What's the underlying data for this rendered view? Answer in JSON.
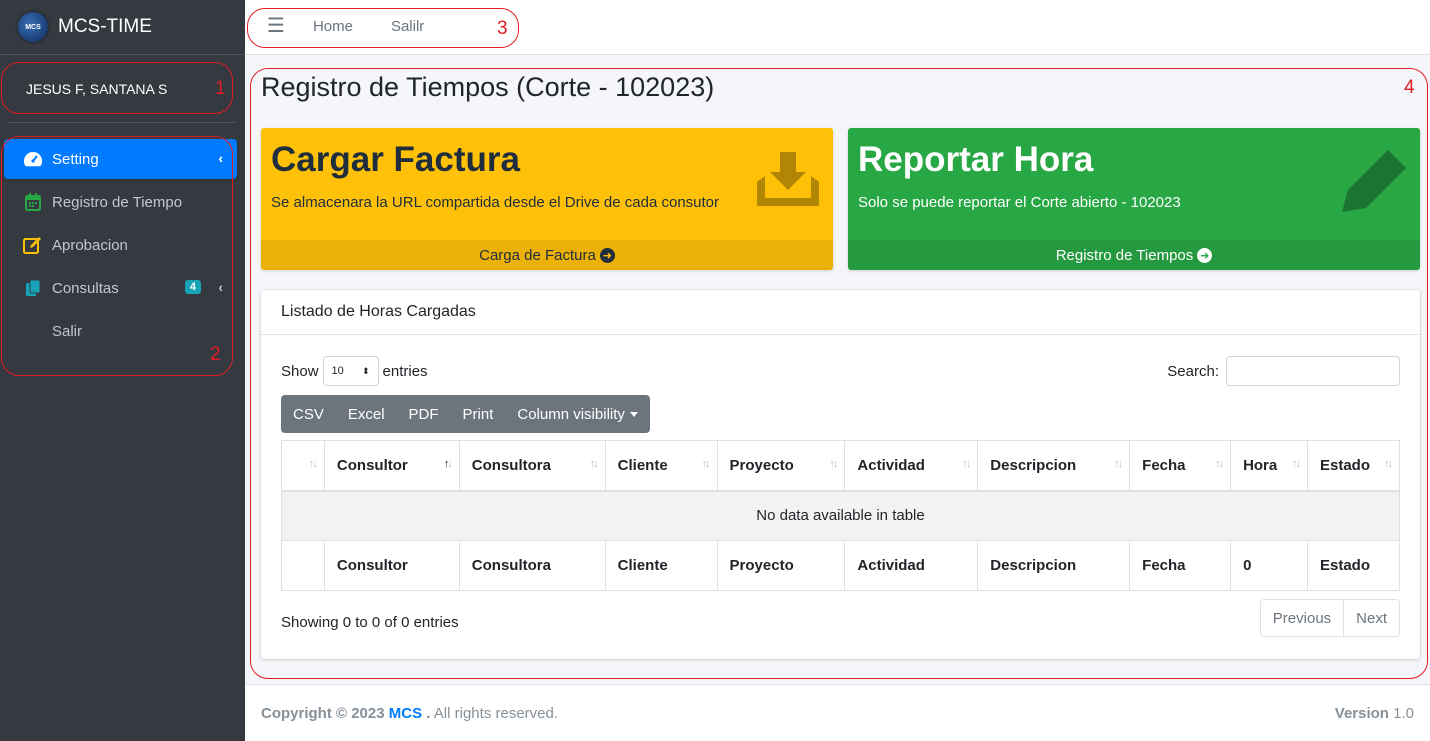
{
  "brand": {
    "name": "MCS-TIME",
    "logo_text": "MCS"
  },
  "user": {
    "name": "JESUS F, SANTANA S"
  },
  "sidebar": {
    "items": [
      {
        "label": "Setting",
        "icon": "tachometer-icon"
      },
      {
        "label": "Registro de Tiempo",
        "icon": "calendar-icon"
      },
      {
        "label": "Aprobacion",
        "icon": "edit-icon"
      },
      {
        "label": "Consultas",
        "icon": "copy-icon",
        "badge": "4"
      },
      {
        "label": "Salir"
      }
    ]
  },
  "navbar": {
    "links": [
      "Home",
      "Salilr"
    ]
  },
  "annotations": [
    "1",
    "2",
    "3",
    "4"
  ],
  "page": {
    "title": "Registro de Tiempos (Corte - 102023)"
  },
  "boxes": {
    "factura": {
      "title": "Cargar Factura",
      "text": "Se almacenara la URL compartida desde el Drive de cada consutor",
      "footer": "Carga de Factura",
      "color": "#ffc107"
    },
    "hora": {
      "title": "Reportar Hora",
      "text": "Solo se puede reportar el Corte abierto - 102023",
      "footer": "Registro de Tiempos",
      "color": "#28a745"
    }
  },
  "card": {
    "title": "Listado de Horas Cargadas",
    "show_label": "Show",
    "entries_value": "10",
    "entries_label": "entries",
    "search_label": "Search:",
    "buttons": [
      "CSV",
      "Excel",
      "PDF",
      "Print",
      "Column visibility"
    ],
    "columns": [
      "",
      "Consultor",
      "Consultora",
      "Cliente",
      "Proyecto",
      "Actividad",
      "Descripcion",
      "Fecha",
      "Hora",
      "Estado"
    ],
    "empty_message": "No data available in table",
    "footer_columns": [
      "",
      "Consultor",
      "Consultora",
      "Cliente",
      "Proyecto",
      "Actividad",
      "Descripcion",
      "Fecha",
      "0",
      "Estado"
    ],
    "info": "Showing 0 to 0 of 0 entries",
    "pagination": {
      "previous": "Previous",
      "next": "Next"
    }
  },
  "footer": {
    "copyright": "Copyright © 2023",
    "company": "MCS",
    "dot": ".",
    "rights": "All rights reserved.",
    "version_label": "Version",
    "version": "1.0"
  }
}
